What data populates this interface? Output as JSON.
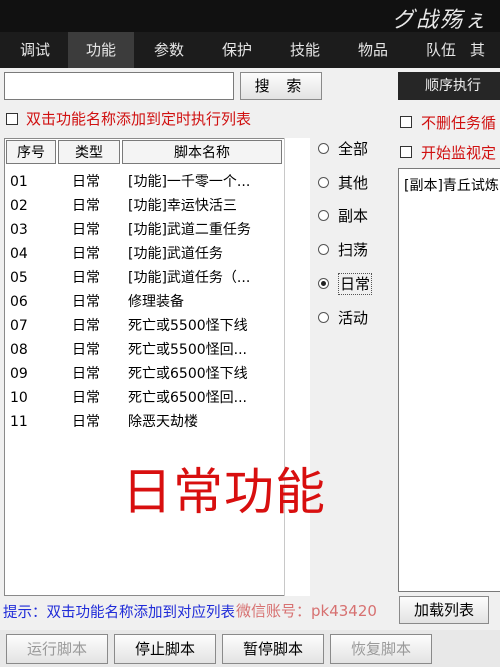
{
  "window": {
    "title": "グ战殇ぇ"
  },
  "tabs": [
    {
      "label": "调试",
      "active": false
    },
    {
      "label": "功能",
      "active": true
    },
    {
      "label": "参数",
      "active": false
    },
    {
      "label": "保护",
      "active": false
    },
    {
      "label": "技能",
      "active": false
    },
    {
      "label": "物品",
      "active": false
    },
    {
      "label": "队伍",
      "active": false
    },
    {
      "label": "其",
      "active": false
    }
  ],
  "search": {
    "value": "",
    "button_label": "搜 索"
  },
  "add_timer_checkbox": {
    "label": "双击功能名称添加到定时执行列表",
    "checked": false
  },
  "table": {
    "columns": [
      "序号",
      "类型",
      "脚本名称"
    ],
    "rows": [
      {
        "num": "01",
        "type": "日常",
        "name": "[功能]一千零一个..."
      },
      {
        "num": "02",
        "type": "日常",
        "name": "[功能]幸运快活三"
      },
      {
        "num": "03",
        "type": "日常",
        "name": "[功能]武道二重任务"
      },
      {
        "num": "04",
        "type": "日常",
        "name": "[功能]武道任务"
      },
      {
        "num": "05",
        "type": "日常",
        "name": "[功能]武道任务（..."
      },
      {
        "num": "06",
        "type": "日常",
        "name": "修理装备"
      },
      {
        "num": "07",
        "type": "日常",
        "name": "死亡或5500怪下线"
      },
      {
        "num": "08",
        "type": "日常",
        "name": "死亡或5500怪回..."
      },
      {
        "num": "09",
        "type": "日常",
        "name": "死亡或6500怪下线"
      },
      {
        "num": "10",
        "type": "日常",
        "name": "死亡或6500怪回..."
      },
      {
        "num": "11",
        "type": "日常",
        "name": "除恶天劫楼"
      }
    ]
  },
  "filters": [
    {
      "label": "全部",
      "selected": false
    },
    {
      "label": "其他",
      "selected": false
    },
    {
      "label": "副本",
      "selected": false
    },
    {
      "label": "扫荡",
      "selected": false
    },
    {
      "label": "日常",
      "selected": true
    },
    {
      "label": "活动",
      "selected": false
    }
  ],
  "right_panel": {
    "header": "顺序执行",
    "options": [
      {
        "label": "不删任务循",
        "checked": false
      },
      {
        "label": "开始监视定",
        "checked": false
      }
    ],
    "list": [
      "[副本]青丘试炼"
    ],
    "load_button": "加载列表"
  },
  "overlay_text": "日常功能",
  "hint": "提示：双击功能名称添加到对应列表",
  "watermark": "微信账号：pk43420",
  "bottom_buttons": [
    {
      "label": "运行脚本",
      "enabled": false
    },
    {
      "label": "停止脚本",
      "enabled": true
    },
    {
      "label": "暂停脚本",
      "enabled": true
    },
    {
      "label": "恢复脚本",
      "enabled": false
    }
  ]
}
